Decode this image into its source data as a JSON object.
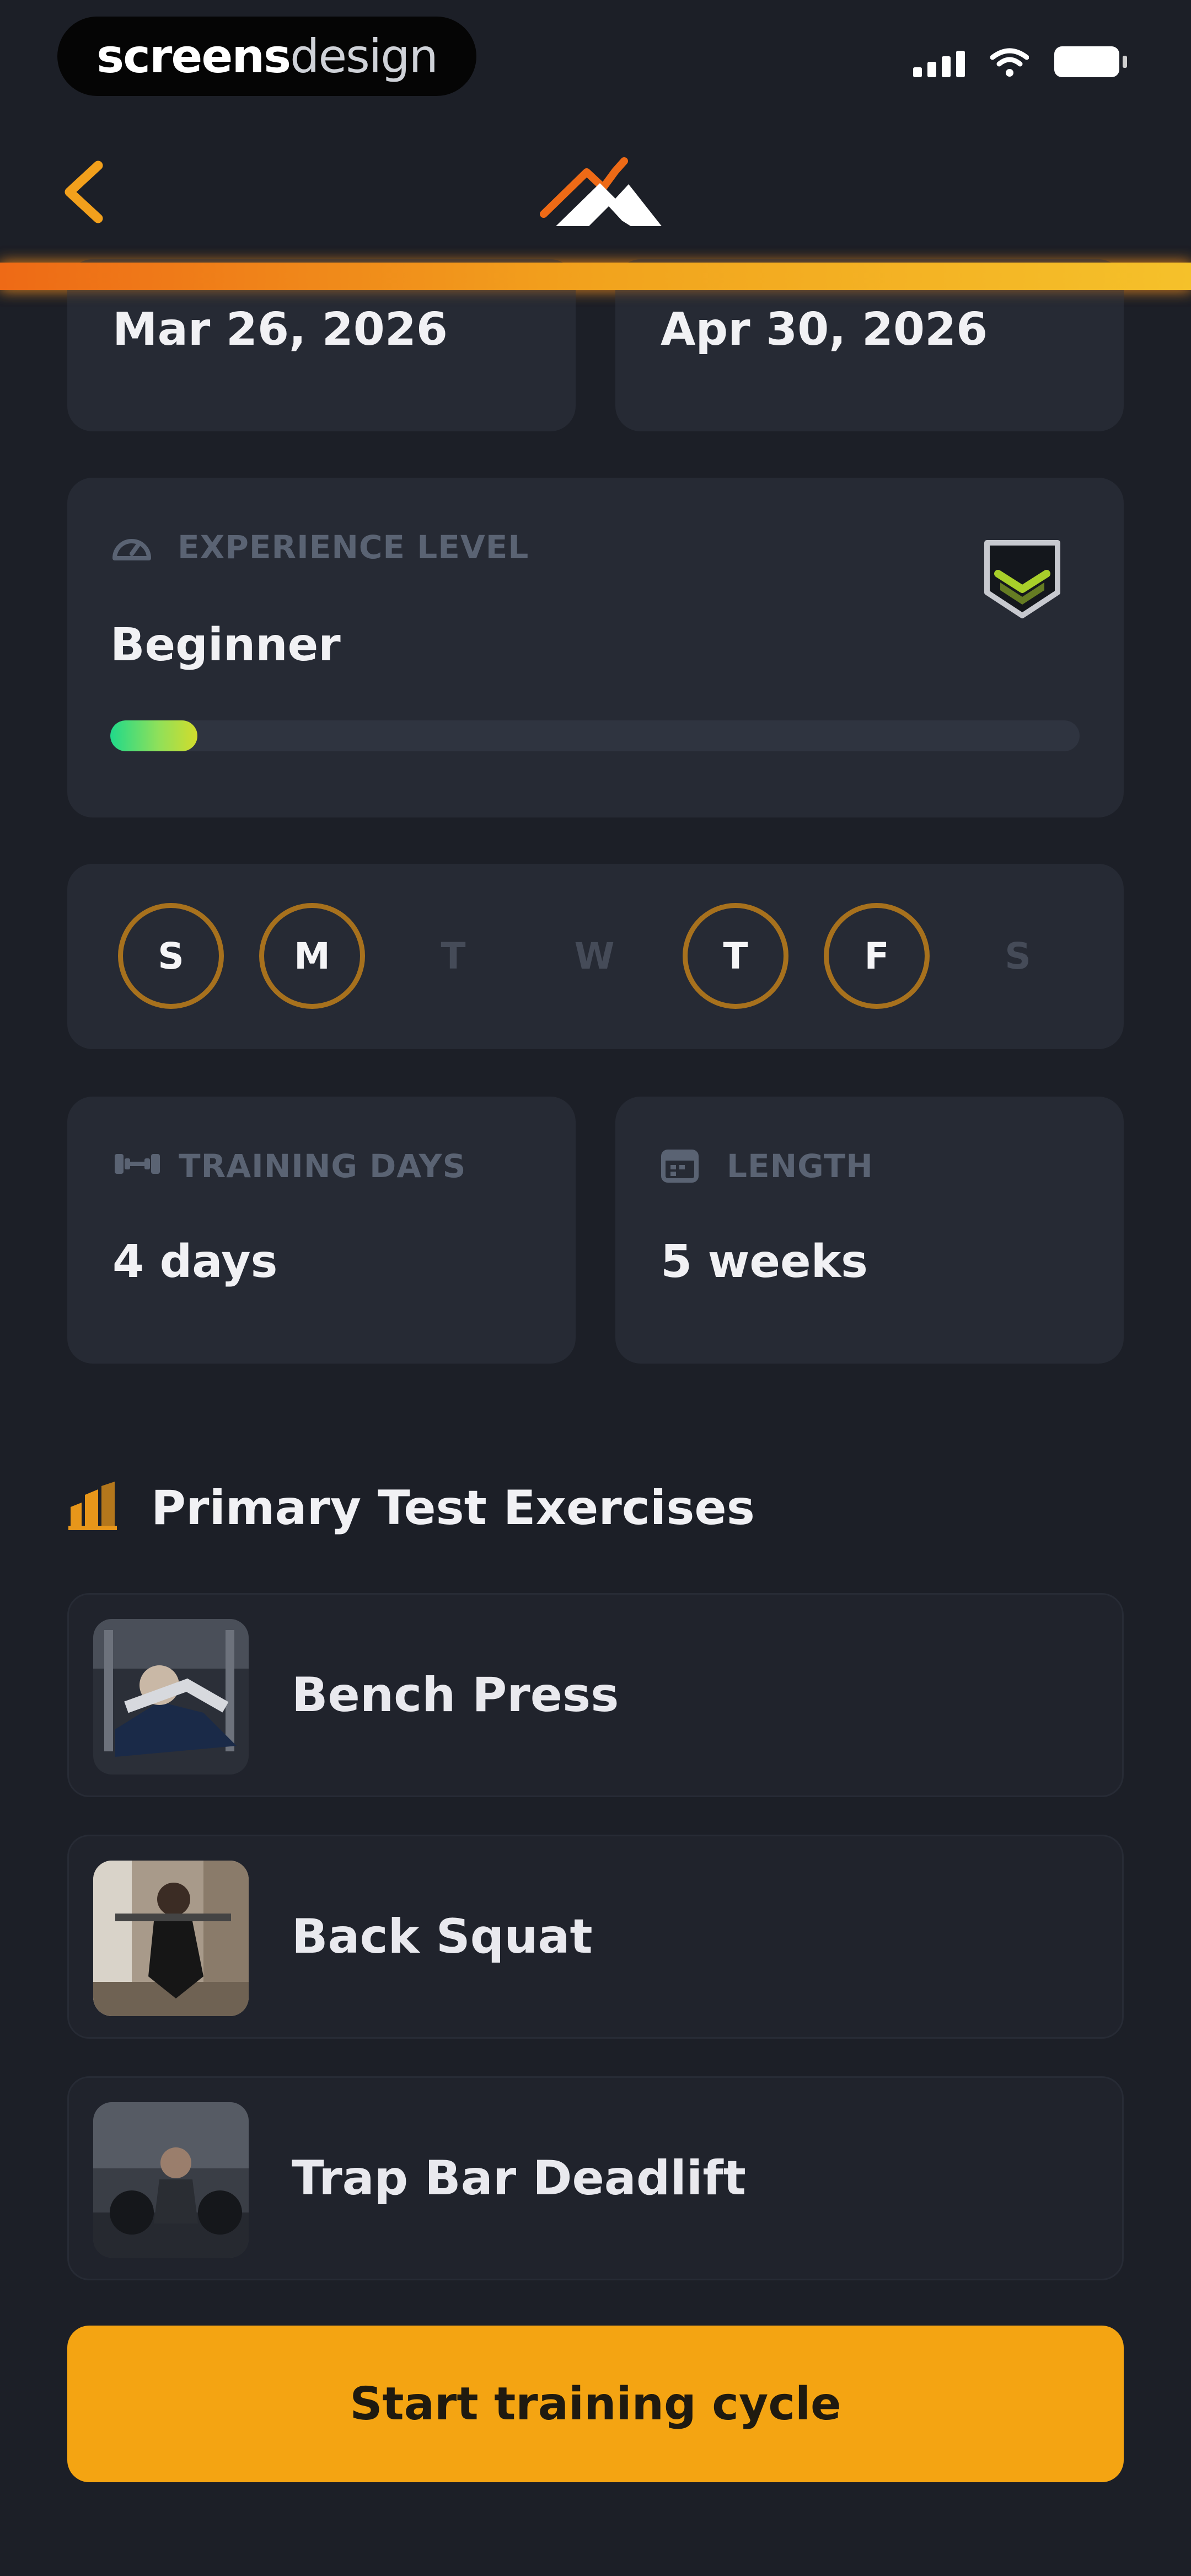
{
  "status_bar": {
    "brand_part1": "screens",
    "brand_part2": "design"
  },
  "header": {
    "back_icon": "chevron-left-icon",
    "logo_icon": "mountain-logo-icon"
  },
  "dates": {
    "start": "Mar 26, 2026",
    "end": "Apr 30, 2026"
  },
  "experience": {
    "label": "EXPERIENCE LEVEL",
    "value": "Beginner",
    "progress": 0.09,
    "badge_icon": "rank-shield-icon"
  },
  "weekdays": [
    {
      "letter": "S",
      "selected": true
    },
    {
      "letter": "M",
      "selected": true
    },
    {
      "letter": "T",
      "selected": false
    },
    {
      "letter": "W",
      "selected": false
    },
    {
      "letter": "T",
      "selected": true
    },
    {
      "letter": "F",
      "selected": true
    },
    {
      "letter": "S",
      "selected": false
    }
  ],
  "stats": {
    "training_days": {
      "label": "TRAINING DAYS",
      "value": "4 days",
      "icon": "dumbbell-icon"
    },
    "length": {
      "label": "LENGTH",
      "value": "5 weeks",
      "icon": "calendar-icon"
    }
  },
  "exercises_section": {
    "title": "Primary Test Exercises",
    "icon": "weight-plate-icon"
  },
  "exercises": [
    {
      "name": "Bench Press"
    },
    {
      "name": "Back Squat"
    },
    {
      "name": "Trap Bar Deadlift"
    }
  ],
  "cta": {
    "label": "Start training cycle"
  },
  "colors": {
    "background": "#1c1f27",
    "card": "#262a34",
    "accent": "#f4a412",
    "ring": "#a7711d",
    "progress_start": "#20d98a",
    "progress_end": "#d2dc2c"
  }
}
